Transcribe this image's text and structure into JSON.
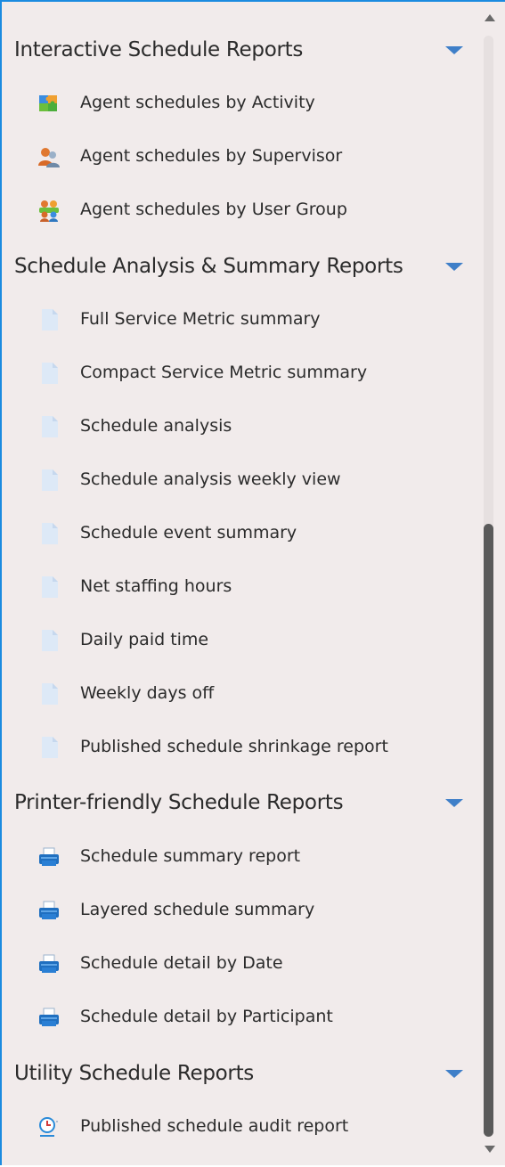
{
  "sections": [
    {
      "title": "Interactive Schedule Reports",
      "items": [
        {
          "label": "Agent schedules by Activity",
          "icon": "activity-puzzle-icon"
        },
        {
          "label": "Agent schedules by Supervisor",
          "icon": "supervisor-people-icon"
        },
        {
          "label": "Agent schedules by User Group",
          "icon": "user-group-icon"
        }
      ]
    },
    {
      "title": "Schedule Analysis & Summary Reports",
      "items": [
        {
          "label": "Full Service Metric summary",
          "icon": "document-icon"
        },
        {
          "label": "Compact Service Metric summary",
          "icon": "document-icon"
        },
        {
          "label": "Schedule analysis",
          "icon": "document-icon"
        },
        {
          "label": "Schedule analysis weekly view",
          "icon": "document-icon"
        },
        {
          "label": "Schedule event summary",
          "icon": "document-icon"
        },
        {
          "label": "Net staffing hours",
          "icon": "document-icon"
        },
        {
          "label": "Daily paid time",
          "icon": "document-icon"
        },
        {
          "label": "Weekly days off",
          "icon": "document-icon"
        },
        {
          "label": "Published schedule shrinkage report",
          "icon": "document-icon"
        }
      ]
    },
    {
      "title": "Printer-friendly Schedule Reports",
      "items": [
        {
          "label": "Schedule summary report",
          "icon": "printer-icon"
        },
        {
          "label": "Layered schedule summary",
          "icon": "printer-icon"
        },
        {
          "label": "Schedule detail by Date",
          "icon": "printer-icon"
        },
        {
          "label": "Schedule detail by Participant",
          "icon": "printer-icon"
        }
      ]
    },
    {
      "title": "Utility Schedule Reports",
      "items": [
        {
          "label": "Published schedule audit report",
          "icon": "clock-audit-icon"
        }
      ]
    }
  ],
  "colors": {
    "accent": "#3f7fc8",
    "border": "#1b8be0",
    "background": "#f1ebeb"
  }
}
